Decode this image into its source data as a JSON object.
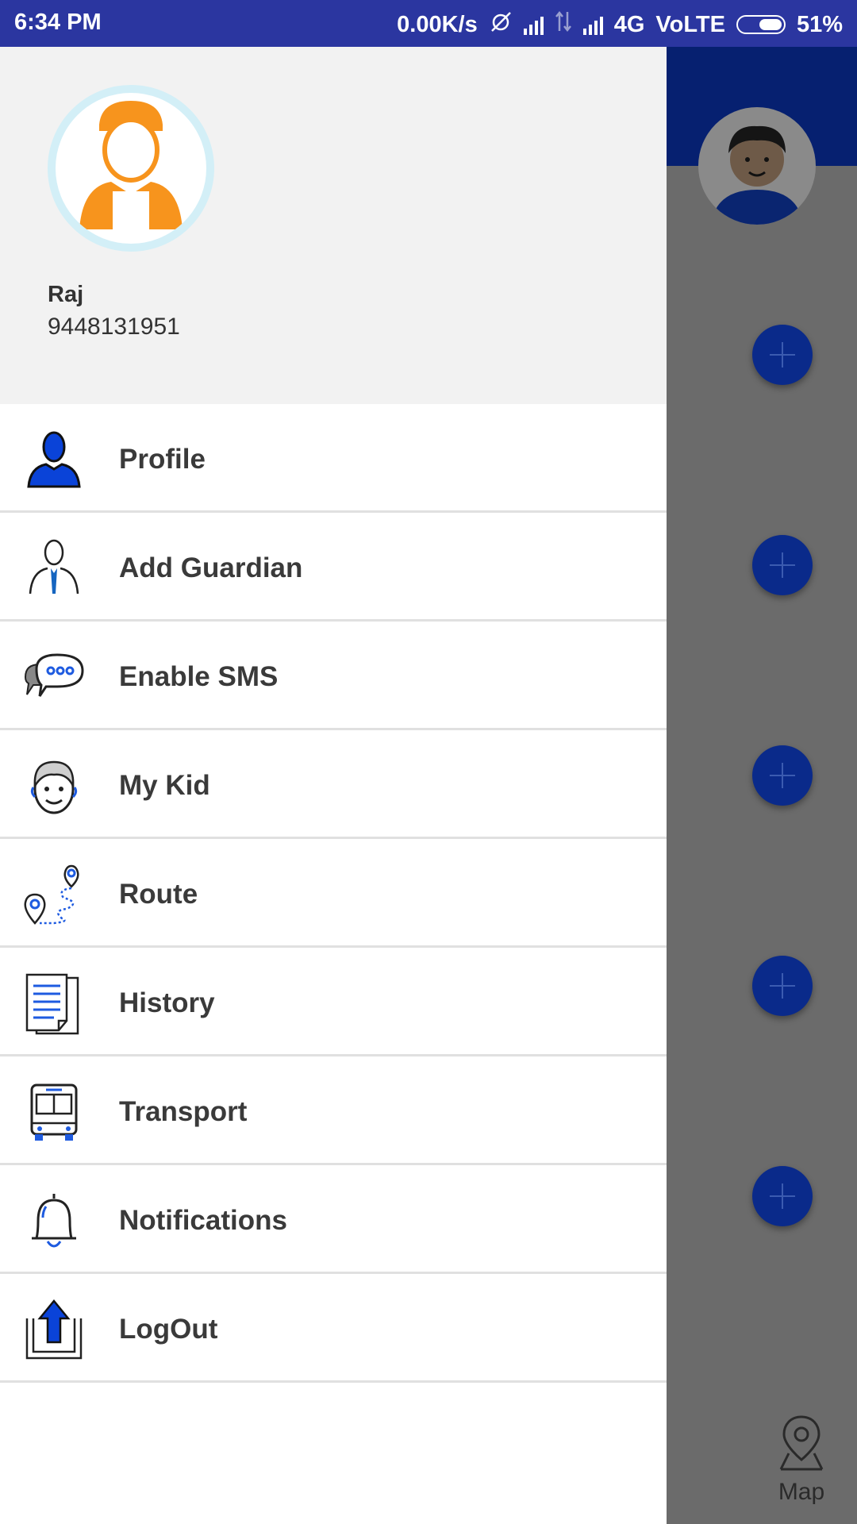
{
  "status_bar": {
    "time": "6:34 PM",
    "net_speed": "0.00K/s",
    "network": "4G",
    "volte": "VoLTE",
    "battery": "51%"
  },
  "drawer": {
    "user": {
      "name": "Raj",
      "phone": "9448131951"
    },
    "items": [
      {
        "label": "Profile",
        "icon": "profile-icon"
      },
      {
        "label": "Add Guardian",
        "icon": "guardian-icon"
      },
      {
        "label": "Enable SMS",
        "icon": "sms-icon"
      },
      {
        "label": "My Kid",
        "icon": "kid-icon"
      },
      {
        "label": "Route",
        "icon": "route-icon"
      },
      {
        "label": "History",
        "icon": "history-icon"
      },
      {
        "label": "Transport",
        "icon": "bus-icon"
      },
      {
        "label": "Notifications",
        "icon": "bell-icon"
      },
      {
        "label": "LogOut",
        "icon": "logout-icon"
      }
    ]
  },
  "background_app": {
    "bottom_tab_label": "Map"
  },
  "colors": {
    "status_bar": "#2b36a0",
    "accent_blue": "#0a2a8a",
    "avatar_orange": "#f7941d"
  }
}
